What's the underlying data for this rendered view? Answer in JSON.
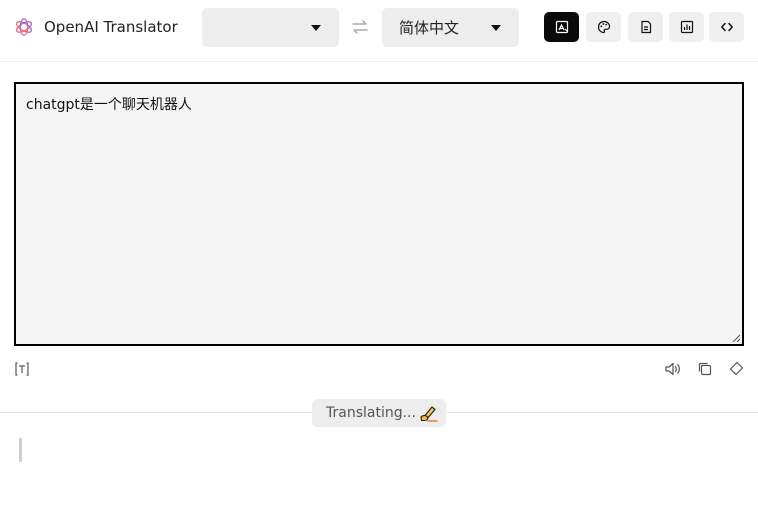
{
  "app": {
    "title": "OpenAI Translator"
  },
  "icons": {
    "logo": "openai-logo-icon",
    "swap": "swap-arrows-icon",
    "screenshot": "screenshot-translate-icon",
    "theme": "palette-icon",
    "vocabulary": "vocabulary-book-icon",
    "stats": "bar-chart-icon",
    "devtools": "code-brackets-icon",
    "format": "format-icon",
    "speak": "speaker-icon",
    "copy": "copy-icon",
    "clear": "eraser-icon",
    "translating": "writing-hand-icon"
  },
  "colors": {
    "accent": "#0a0a0a",
    "surface": "#ededed",
    "input_bg": "#f5f5f5"
  },
  "languages": {
    "source": "",
    "target": "简体中文"
  },
  "input": {
    "text": "chatgpt是一个聊天机器人"
  },
  "status": {
    "text": "Translating..."
  },
  "output": {
    "text": ""
  }
}
